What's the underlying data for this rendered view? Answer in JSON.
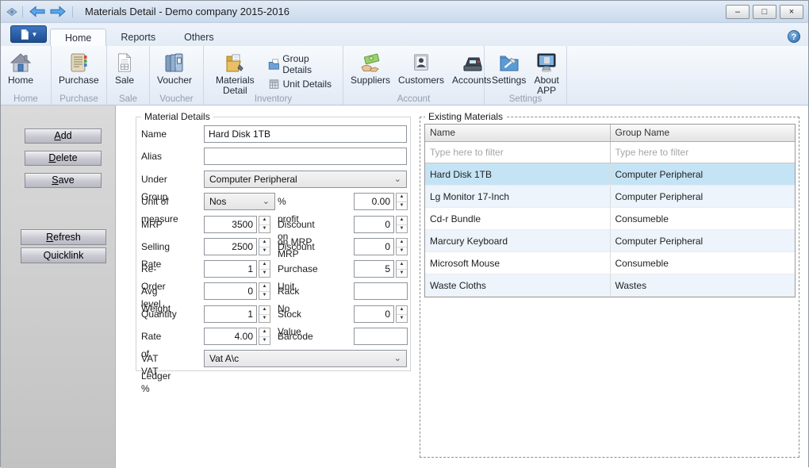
{
  "window": {
    "title": "Materials Detail - Demo company 2015-2016",
    "minimize": "–",
    "maximize": "□",
    "close": "×",
    "help": "?"
  },
  "tabs": [
    {
      "label": "Home",
      "active": true
    },
    {
      "label": "Reports",
      "active": false
    },
    {
      "label": "Others",
      "active": false
    }
  ],
  "ribbon": {
    "groups": [
      {
        "label": "Home",
        "button": {
          "label": "Home"
        }
      },
      {
        "label": "Purchase",
        "button": {
          "label": "Purchase"
        }
      },
      {
        "label": "Sale",
        "button": {
          "label": "Sale"
        }
      },
      {
        "label": "Voucher",
        "button": {
          "label": "Voucher"
        }
      },
      {
        "label": "Inventory",
        "button": {
          "label": "Materials Detail"
        },
        "small_buttons": [
          {
            "label": "Group Details"
          },
          {
            "label": "Unit Details"
          }
        ]
      },
      {
        "label": "Account",
        "buttons": [
          {
            "label": "Suppliers"
          },
          {
            "label": "Customers"
          },
          {
            "label": "Accounts"
          }
        ]
      },
      {
        "label": "Settings",
        "buttons": [
          {
            "label": "Settings"
          },
          {
            "label": "About APP"
          }
        ]
      }
    ]
  },
  "sidebar": {
    "buttons": [
      {
        "label": "Add",
        "underline": 0
      },
      {
        "label": "Delete",
        "underline": 0
      },
      {
        "label": "Save",
        "underline": 0
      },
      {
        "label": "Refresh",
        "underline": 0
      },
      {
        "label": "Quicklink",
        "underline": -1
      }
    ]
  },
  "form": {
    "legend": "Material Details",
    "fields": {
      "name": {
        "label": "Name",
        "value": "Hard Disk 1TB"
      },
      "alias": {
        "label": "Alias",
        "value": ""
      },
      "under_group": {
        "label": "Under Group",
        "value": "Computer Peripheral"
      },
      "unit_of_measure": {
        "label": "Unit of measure",
        "value": "Nos"
      },
      "profit_on_mrp": {
        "label": "% profit on MRP",
        "value": "0.00"
      },
      "mrp": {
        "label": "MRP",
        "value": "3500"
      },
      "discount_on_mrp": {
        "label": "Discount on MRP",
        "value": "0"
      },
      "selling_rate": {
        "label": "Selling Rate",
        "value": "2500"
      },
      "discount": {
        "label": "Discount",
        "value": "0"
      },
      "reorder_level": {
        "label": "Re-Order level",
        "value": "1"
      },
      "purchase_unit": {
        "label": "Purchase Unit",
        "value": "5"
      },
      "avg_weight": {
        "label": "Avg Weight",
        "value": "0"
      },
      "rack_no": {
        "label": "Rack No",
        "value": ""
      },
      "quantity": {
        "label": "Quantity",
        "value": "1"
      },
      "stock_value": {
        "label": "Stock Value",
        "value": "0"
      },
      "rate_of_vat": {
        "label": "Rate of VAT %",
        "value": "4.00"
      },
      "barcode": {
        "label": "Barcode",
        "value": ""
      },
      "vat_ledger": {
        "label": "VAT Ledger",
        "value": "Vat A\\c"
      }
    }
  },
  "materials_table": {
    "legend": "Existing Materials",
    "columns": [
      "Name",
      "Group Name"
    ],
    "filter_placeholder": "Type here to filter",
    "selected_index": 0,
    "rows": [
      [
        "Hard Disk 1TB",
        "Computer Peripheral"
      ],
      [
        "Lg Monitor 17-Inch",
        "Computer Peripheral"
      ],
      [
        "Cd-r Bundle",
        "Consumeble"
      ],
      [
        "Marcury Keyboard",
        "Computer Peripheral"
      ],
      [
        "Microsoft Mouse",
        "Consumeble"
      ],
      [
        "Waste Cloths",
        "Wastes"
      ]
    ]
  }
}
